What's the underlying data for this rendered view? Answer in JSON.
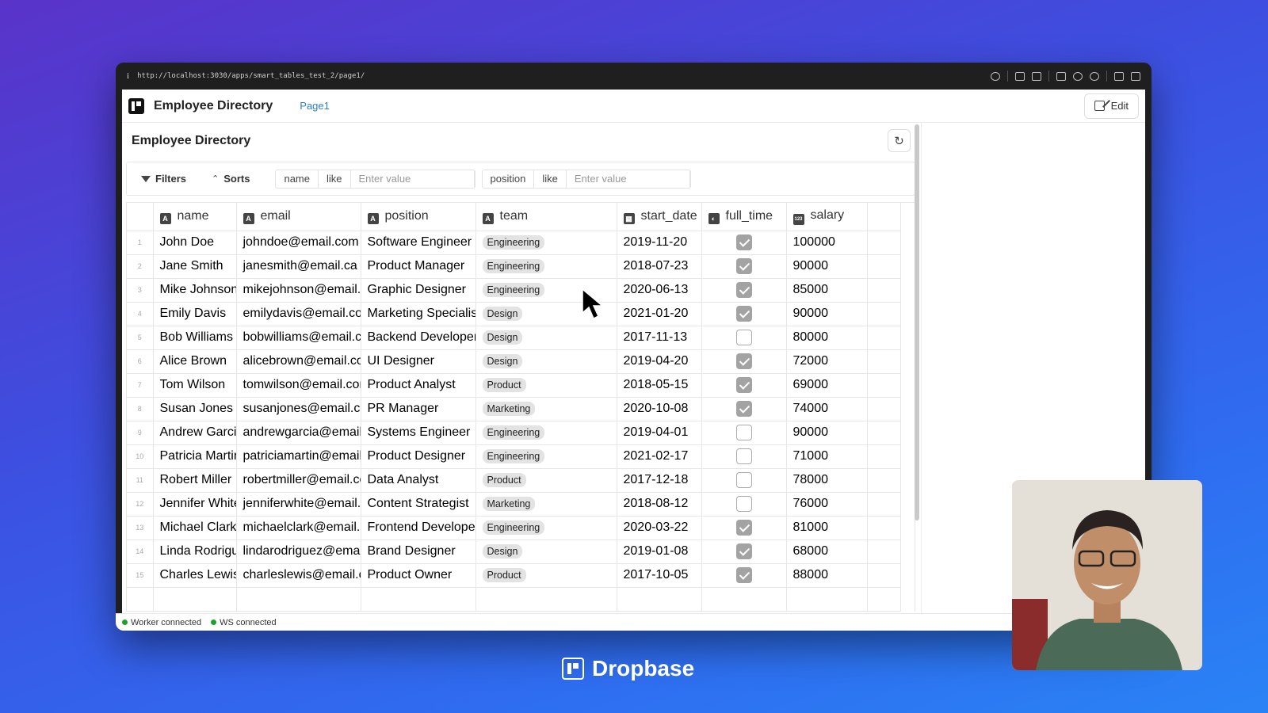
{
  "browser": {
    "url": "http://localhost:3030/apps/smart_tables_test_2/page1/",
    "info_icon": "i"
  },
  "app": {
    "title": "Employee Directory",
    "page_link": "Page1",
    "edit_label": "Edit"
  },
  "table": {
    "title": "Employee Directory",
    "refresh_icon": "↻",
    "filters_label": "Filters",
    "sorts_label": "Sorts",
    "filter1": {
      "column": "name",
      "op": "like",
      "placeholder": "Enter value"
    },
    "filter2": {
      "column": "position",
      "op": "like",
      "placeholder": "Enter value"
    },
    "columns": [
      {
        "name": "name",
        "icon": "A"
      },
      {
        "name": "email",
        "icon": "A"
      },
      {
        "name": "position",
        "icon": "A"
      },
      {
        "name": "team",
        "icon": "A"
      },
      {
        "name": "start_date",
        "icon": "▦"
      },
      {
        "name": "full_time",
        "icon": "◐"
      },
      {
        "name": "salary",
        "icon": "123"
      }
    ],
    "rows": [
      {
        "n": "1",
        "name": "John Doe",
        "email": "johndoe@email.com",
        "position": "Software Engineer",
        "team": "Engineering",
        "start_date": "2019-11-20",
        "full_time": true,
        "salary": "100000"
      },
      {
        "n": "2",
        "name": "Jane Smith",
        "email": "janesmith@email.ca",
        "position": "Product Manager",
        "team": "Engineering",
        "start_date": "2018-07-23",
        "full_time": true,
        "salary": "90000"
      },
      {
        "n": "3",
        "name": "Mike Johnson",
        "email": "mikejohnson@email.com",
        "position": "Graphic Designer",
        "team": "Engineering",
        "start_date": "2020-06-13",
        "full_time": true,
        "salary": "85000"
      },
      {
        "n": "4",
        "name": "Emily Davis",
        "email": "emilydavis@email.com",
        "position": "Marketing Specialist",
        "team": "Design",
        "start_date": "2021-01-20",
        "full_time": true,
        "salary": "90000"
      },
      {
        "n": "5",
        "name": "Bob Williams",
        "email": "bobwilliams@email.com",
        "position": "Backend Developer",
        "team": "Design",
        "start_date": "2017-11-13",
        "full_time": false,
        "salary": "80000"
      },
      {
        "n": "6",
        "name": "Alice Brown",
        "email": "alicebrown@email.com",
        "position": "UI Designer",
        "team": "Design",
        "start_date": "2019-04-20",
        "full_time": true,
        "salary": "72000"
      },
      {
        "n": "7",
        "name": "Tom Wilson",
        "email": "tomwilson@email.com",
        "position": "Product Analyst",
        "team": "Product",
        "start_date": "2018-05-15",
        "full_time": true,
        "salary": "69000"
      },
      {
        "n": "8",
        "name": "Susan Jones",
        "email": "susanjones@email.com",
        "position": "PR Manager",
        "team": "Marketing",
        "start_date": "2020-10-08",
        "full_time": true,
        "salary": "74000"
      },
      {
        "n": "9",
        "name": "Andrew Garcia",
        "email": "andrewgarcia@email.com",
        "position": "Systems Engineer",
        "team": "Engineering",
        "start_date": "2019-04-01",
        "full_time": false,
        "salary": "90000"
      },
      {
        "n": "10",
        "name": "Patricia Martin",
        "email": "patriciamartin@email.com",
        "position": "Product Designer",
        "team": "Engineering",
        "start_date": "2021-02-17",
        "full_time": false,
        "salary": "71000"
      },
      {
        "n": "11",
        "name": "Robert Miller",
        "email": "robertmiller@email.com",
        "position": "Data Analyst",
        "team": "Product",
        "start_date": "2017-12-18",
        "full_time": false,
        "salary": "78000"
      },
      {
        "n": "12",
        "name": "Jennifer White",
        "email": "jenniferwhite@email.com",
        "position": "Content Strategist",
        "team": "Marketing",
        "start_date": "2018-08-12",
        "full_time": false,
        "salary": "76000"
      },
      {
        "n": "13",
        "name": "Michael Clark",
        "email": "michaelclark@email.com",
        "position": "Frontend Developer",
        "team": "Engineering",
        "start_date": "2020-03-22",
        "full_time": true,
        "salary": "81000"
      },
      {
        "n": "14",
        "name": "Linda Rodriguez",
        "email": "lindarodriguez@email.com",
        "position": "Brand Designer",
        "team": "Design",
        "start_date": "2019-01-08",
        "full_time": true,
        "salary": "68000"
      },
      {
        "n": "15",
        "name": "Charles Lewis",
        "email": "charleslewis@email.com",
        "position": "Product Owner",
        "team": "Product",
        "start_date": "2017-10-05",
        "full_time": true,
        "salary": "88000"
      }
    ]
  },
  "status": {
    "worker": "Worker connected",
    "ws": "WS connected",
    "color": "#1aa12b"
  },
  "brand": {
    "name": "Dropbase"
  }
}
